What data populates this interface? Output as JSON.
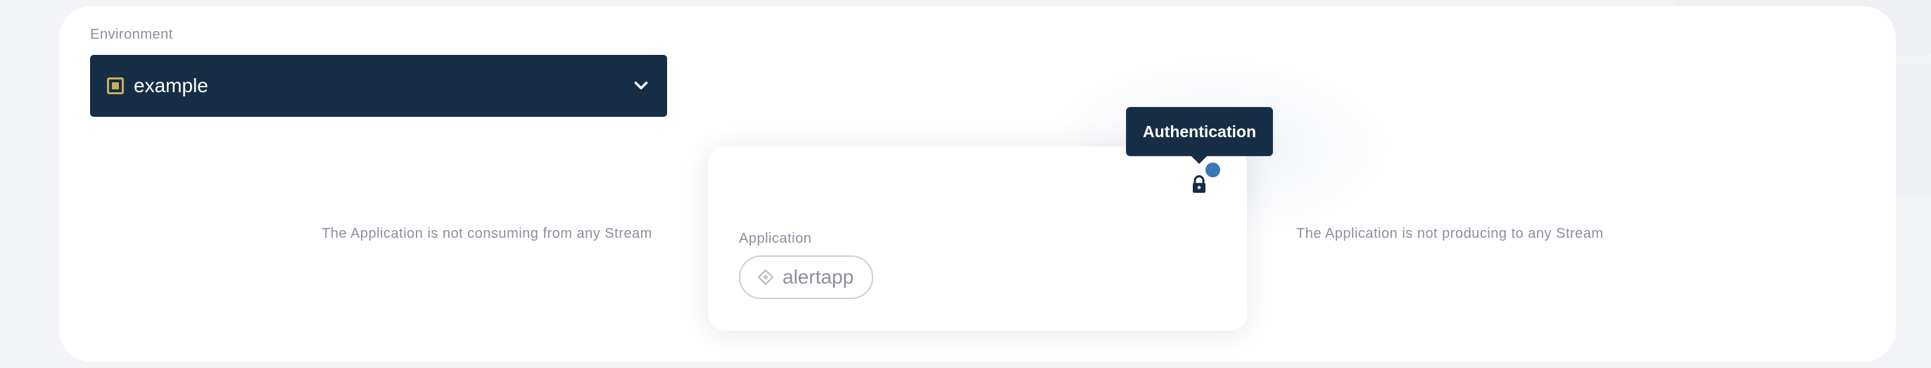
{
  "environment": {
    "label": "Environment",
    "selected": "example",
    "icon": "environment-icon",
    "chevron_icon": "chevron-down-icon"
  },
  "flow": {
    "consuming_text": "The Application is not consuming from any Stream",
    "producing_text": "The Application is not producing to any Stream"
  },
  "application": {
    "label": "Application",
    "name": "alertapp",
    "icon": "application-diamond-icon",
    "lock_icon": "lock-icon",
    "status_dot_color": "#3a78b5"
  },
  "tooltip": {
    "text": "Authentication"
  },
  "colors": {
    "background": "#f3f4f7",
    "card": "#ffffff",
    "dark_navy": "#152e45",
    "accent_gold": "#c9ad5b",
    "muted_text": "#8a8f9c",
    "status_blue": "#3a78b5"
  }
}
